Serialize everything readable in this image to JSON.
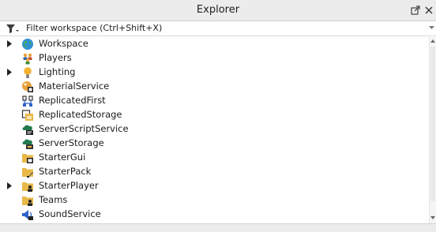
{
  "window": {
    "title": "Explorer",
    "undock_icon": "undock-icon",
    "close_icon": "close-icon"
  },
  "filter": {
    "icon": "filter-funnel-icon",
    "placeholder": "Filter workspace (Ctrl+Shift+X)",
    "value": "",
    "dropdown_icon": "chevron-down-icon"
  },
  "tree": {
    "items": [
      {
        "label": "Workspace",
        "expandable": true,
        "icon": "workspace-globe-icon"
      },
      {
        "label": "Players",
        "expandable": false,
        "icon": "players-icon"
      },
      {
        "label": "Lighting",
        "expandable": true,
        "icon": "lightbulb-icon"
      },
      {
        "label": "MaterialService",
        "expandable": false,
        "icon": "material-service-icon"
      },
      {
        "label": "ReplicatedFirst",
        "expandable": false,
        "icon": "replicated-first-icon"
      },
      {
        "label": "ReplicatedStorage",
        "expandable": false,
        "icon": "replicated-storage-icon"
      },
      {
        "label": "ServerScriptService",
        "expandable": false,
        "icon": "server-script-service-icon"
      },
      {
        "label": "ServerStorage",
        "expandable": false,
        "icon": "server-storage-icon"
      },
      {
        "label": "StarterGui",
        "expandable": false,
        "icon": "starter-gui-icon"
      },
      {
        "label": "StarterPack",
        "expandable": false,
        "icon": "starter-pack-icon"
      },
      {
        "label": "StarterPlayer",
        "expandable": true,
        "icon": "starter-player-icon"
      },
      {
        "label": "Teams",
        "expandable": false,
        "icon": "teams-icon"
      },
      {
        "label": "SoundService",
        "expandable": false,
        "icon": "sound-service-icon"
      }
    ]
  },
  "colors": {
    "titlebar_bg": "#ececec",
    "folder_yellow": "#e8b94a",
    "globe_blue": "#2f8fd6",
    "server_green": "#1f7a4d",
    "sound_blue": "#2f63c9"
  }
}
